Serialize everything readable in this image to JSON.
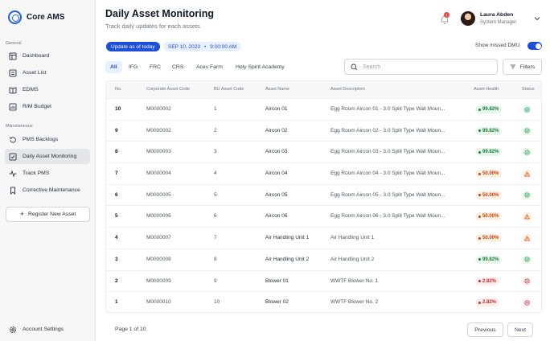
{
  "app": {
    "name": "Core AMS"
  },
  "sidebar": {
    "general_label": "General",
    "general_items": [
      {
        "label": "Dashboard",
        "icon": "layout-icon"
      },
      {
        "label": "Asset List",
        "icon": "list-icon"
      },
      {
        "label": "EDMS",
        "icon": "book-icon"
      },
      {
        "label": "R/M Budget",
        "icon": "budget-icon"
      }
    ],
    "misc_label": "Miscelaneous",
    "misc_items": [
      {
        "label": "PMS Backlogs",
        "icon": "history-icon"
      },
      {
        "label": "Daily Asset Monitoring",
        "icon": "check-square-icon",
        "active": true
      },
      {
        "label": "Track PMS",
        "icon": "activity-icon"
      },
      {
        "label": "Corrective Maintenance",
        "icon": "bookmark-icon"
      }
    ],
    "register_label": "Register New Asset",
    "account_settings_label": "Account Settings"
  },
  "header": {
    "title": "Daily Asset Monitoring",
    "subtitle": "Track daily updates for each assets",
    "notification_count": "1",
    "user_name": "Laura Abden",
    "user_role": "System Manager"
  },
  "update_bar": {
    "label": "Update as of today",
    "date": "SEP 10, 2023",
    "separator": "•",
    "time": "9:00:00 AM",
    "missed_label": "Show missed DMU",
    "missed_enabled": true
  },
  "tabs": [
    "All",
    "IFG",
    "FRC",
    "CRS",
    "Aces Farm",
    "Holy Spirit Academy"
  ],
  "active_tab": "All",
  "search": {
    "placeholder": "Search"
  },
  "filters_label": "Filters",
  "table": {
    "columns": [
      "No.",
      "Corporate Asset Code",
      "BU Asset Code",
      "Asset Name",
      "Asset Description",
      "Asset Health",
      "Status"
    ],
    "rows": [
      {
        "no": "10",
        "corp": "M0000002",
        "bu": "1",
        "name": "Aircon 01",
        "desc": "Egg Room Aircon 01 - 3.0 Split Type Wall Moun...",
        "health": "99.82%",
        "level": "good"
      },
      {
        "no": "9",
        "corp": "M0000002",
        "bu": "2",
        "name": "Aircon 02",
        "desc": "Egg Room Aircon 02 - 3.0 Split Type Wall Moun...",
        "health": "99.82%",
        "level": "good"
      },
      {
        "no": "8",
        "corp": "M0000003",
        "bu": "3",
        "name": "Aircon 03",
        "desc": "Egg Room Aircon 03 - 3.0 Split Type Wall Moun...",
        "health": "99.82%",
        "level": "good"
      },
      {
        "no": "7",
        "corp": "M0000004",
        "bu": "4",
        "name": "Aircon 04",
        "desc": "Egg Room Aircon 04 - 3.0 Split Type Wall Moun...",
        "health": "50.00%",
        "level": "mid"
      },
      {
        "no": "6",
        "corp": "M0000005",
        "bu": "5",
        "name": "Aircon 05",
        "desc": "Egg Room Aircon 05 - 3.0 Split Type Wall Moun...",
        "health": "50.00%",
        "level": "good"
      },
      {
        "no": "5",
        "corp": "M0000006",
        "bu": "6",
        "name": "Aircon 06",
        "desc": "Egg Room Aircon 06 - 3.0 Split Type Wall Moun...",
        "health": "50.00%",
        "level": "mid"
      },
      {
        "no": "4",
        "corp": "M0000007",
        "bu": "7",
        "name": "Air Handling Unit 1",
        "desc": "Air Handling Unit 1",
        "health": "50.00%",
        "level": "mid"
      },
      {
        "no": "3",
        "corp": "M0000008",
        "bu": "8",
        "name": "Air Handling Unit 2",
        "desc": "Air Handling Unit 2",
        "health": "99.82%",
        "level": "good"
      },
      {
        "no": "2",
        "corp": "M0000009",
        "bu": "9",
        "name": "Blower 01",
        "desc": "WWTF Blower No. 1",
        "health": "2.82%",
        "level": "bad"
      },
      {
        "no": "1",
        "corp": "M0000010",
        "bu": "10",
        "name": "Blower 02",
        "desc": "WWTF Blower No. 2",
        "health": "2.82%",
        "level": "bad"
      }
    ]
  },
  "pagination": {
    "text": "Page 1 of 10",
    "previous": "Previous",
    "next": "Next"
  },
  "colors": {
    "accent": "#1d4ed8",
    "good": "#15803d",
    "warning": "#c2410c",
    "danger": "#dc2626"
  }
}
